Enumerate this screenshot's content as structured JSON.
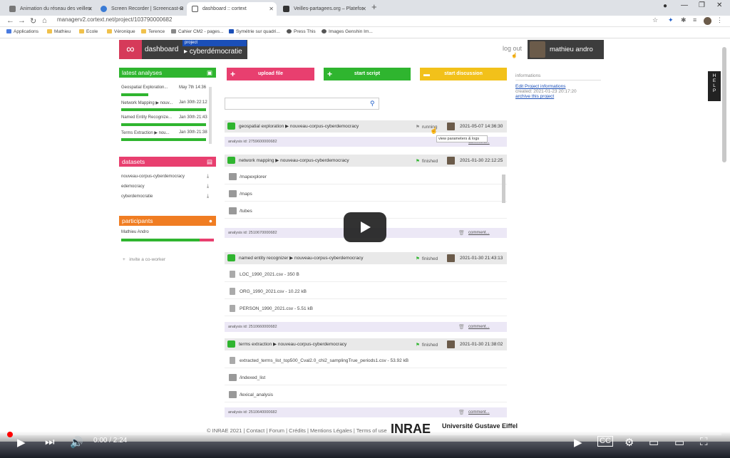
{
  "browser": {
    "tabs": [
      {
        "label": "Animation du réseau des veilleu"
      },
      {
        "label": "Screen Recorder | Screencast-O"
      },
      {
        "label": "dashboard :: cortext"
      },
      {
        "label": "Veilles-partagees.org – Platefor"
      }
    ],
    "url": "managerv2.cortext.net/project/103790000682",
    "bookmarks": [
      "Applications",
      "Mathieu",
      "Ecole",
      "Véronique",
      "Terence",
      "Cahier CM2 - pages...",
      "Symétrie sur quadri...",
      "Press This",
      "Images Genshin Im..."
    ]
  },
  "header": {
    "dashboard_label": "dashboard",
    "project_tag": "project",
    "project_name": "cyberdémocratie",
    "logout_label": "log out",
    "user_name": "mathieu andro"
  },
  "latest_analyses": {
    "title": "latest analyses",
    "items": [
      {
        "name": "Geospatial Exploration...",
        "date": "May 7th 14:36",
        "progress": 0.3
      },
      {
        "name": "Network Mapping ▶ nouv...",
        "date": "Jan 30th 22:12",
        "progress": 1.0
      },
      {
        "name": "Named Entity Recognize...",
        "date": "Jan 30th 21:43",
        "progress": 1.0
      },
      {
        "name": "Terms Extraction ▶ nou...",
        "date": "Jan 30th 21:38",
        "progress": 1.0
      }
    ]
  },
  "datasets": {
    "title": "datasets",
    "items": [
      "nouveau-corpus-cyberdemocracy",
      "edemocracy",
      "cyberdemocratie"
    ]
  },
  "participants": {
    "title": "participants",
    "items": [
      "Mathieu Andro"
    ],
    "invite_label": "invite a co-worker"
  },
  "actions": {
    "upload": "upload file",
    "script": "start script",
    "discussion": "start discussion"
  },
  "colors": {
    "green": "#2fb52f",
    "pink": "#e83f6f",
    "yellow": "#f2c11a",
    "orange": "#f07d22",
    "dark": "#3d3d3d",
    "blue": "#1b4fb8"
  },
  "analyses": [
    {
      "title": "geospatial exploration ▶ nouveau-corpus-cyberdemocracy",
      "status": "running",
      "date": "2021-05-07 14:36:30",
      "id": "analysis id: 2759600000682",
      "comment": "comment...",
      "items": []
    },
    {
      "title": "network mapping ▶ nouveau-corpus-cyberdemocracy",
      "status": "finished",
      "date": "2021-01-30 22:12:25",
      "id": "analysis id: 2510670000682",
      "comment": "comment...",
      "items": [
        "/mapexplorer",
        "/maps",
        "/tubes"
      ]
    },
    {
      "title": "named entity recognizer ▶ nouveau-corpus-cyberdemocracy",
      "status": "finished",
      "date": "2021-01-30 21:43:13",
      "id": "analysis id: 2510660000682",
      "comment": "comment...",
      "items": [
        "LOC_1990_2021.csv - 350 B",
        "ORG_1990_2021.csv - 10.22 kB",
        "PERSON_1990_2021.csv - 5.51 kB"
      ]
    },
    {
      "title": "terms extraction ▶ nouveau-corpus-cyberdemocracy",
      "status": "finished",
      "date": "2021-01-30 21:38:02",
      "id": "analysis id: 2510640000682",
      "comment": "comment...",
      "items": [
        "extracted_terms_list_top500_Cval2.0_chi2_samplingTrue_periods1.csv - 53.92 kB",
        "/indexed_list",
        "/lexical_analysis"
      ]
    }
  ],
  "tooltip": "view parameters & logs",
  "info_panel": {
    "title": "informations",
    "edit_link": "Edit Project informations",
    "created": "created: 2021-01-23 20:17:20",
    "archive_link": "archive this project"
  },
  "help_label": "HELP",
  "footer": {
    "text": "© INRAE 2021 | Contact | Forum | Crédits | Mentions Légales | Terms of use",
    "inrae": "INRAE",
    "uge": "Université Gustave Eiffel"
  },
  "video": {
    "timecode": "0:00 / 2:24"
  }
}
